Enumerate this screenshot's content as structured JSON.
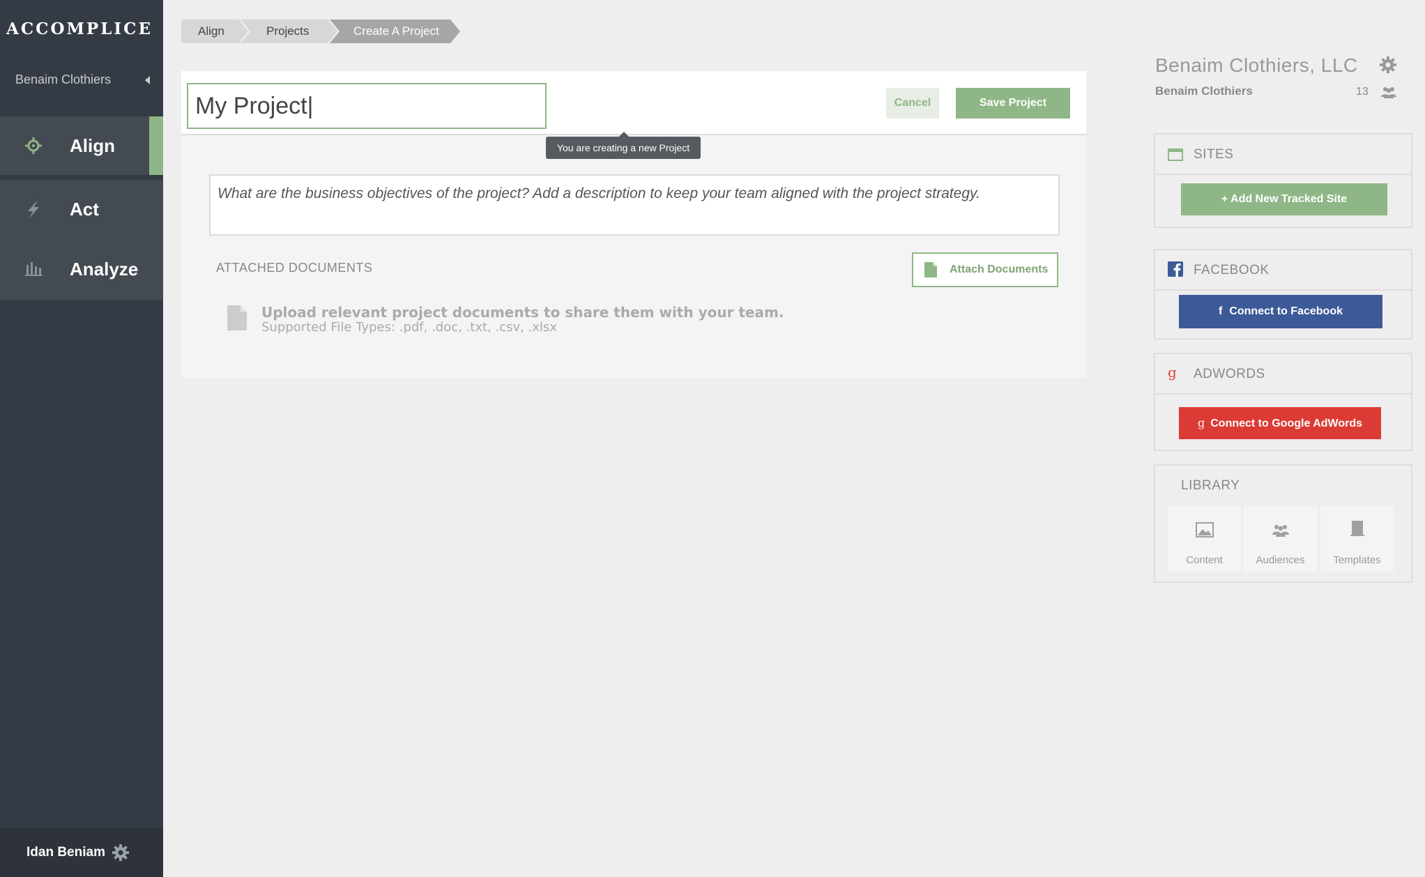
{
  "app": {
    "logo": "Accomplice",
    "account": "Benaim Clothiers"
  },
  "nav": {
    "items": [
      {
        "label": "Align",
        "active": true,
        "icon": "crosshair-icon"
      },
      {
        "label": "Act",
        "active": false,
        "icon": "bolt-icon"
      },
      {
        "label": "Analyze",
        "active": false,
        "icon": "bar-chart-icon"
      }
    ]
  },
  "user": {
    "name": "Idan Beniam"
  },
  "breadcrumb": [
    "Align",
    "Projects",
    "Create A Project"
  ],
  "project_form": {
    "name_value": "My Project|",
    "cancel_label": "Cancel",
    "save_label": "Save Project",
    "tooltip": "You are creating a new Project",
    "description_placeholder": "What are the business objectives of the project? Add a description to keep your team aligned with the project strategy.",
    "attached_heading": "ATTACHED DOCUMENTS",
    "attach_label": "Attach Documents",
    "upload_hint": "Upload relevant project documents to share them with your team.",
    "file_types": "Supported File Types: .pdf, .doc, .txt, .csv, .xlsx"
  },
  "company": {
    "name": "Benaim Clothiers, LLC",
    "subname": "Benaim Clothiers",
    "member_count": "13"
  },
  "panels": {
    "sites": {
      "title": "SITES",
      "button": "+ Add New Tracked Site"
    },
    "facebook": {
      "title": "FACEBOOK",
      "button": "Connect to Facebook"
    },
    "adwords": {
      "title": "ADWORDS",
      "button": "Connect to Google AdWords"
    },
    "library": {
      "title": "LIBRARY",
      "items": [
        {
          "label": "Content",
          "icon": "image-icon"
        },
        {
          "label": "Audiences",
          "icon": "people-icon"
        },
        {
          "label": "Templates",
          "icon": "document-icon"
        }
      ]
    }
  },
  "colors": {
    "sidebar": "#353b44",
    "accent_green": "#8fb686",
    "facebook_blue": "#3d5a98",
    "adwords_red": "#dc3b35"
  }
}
